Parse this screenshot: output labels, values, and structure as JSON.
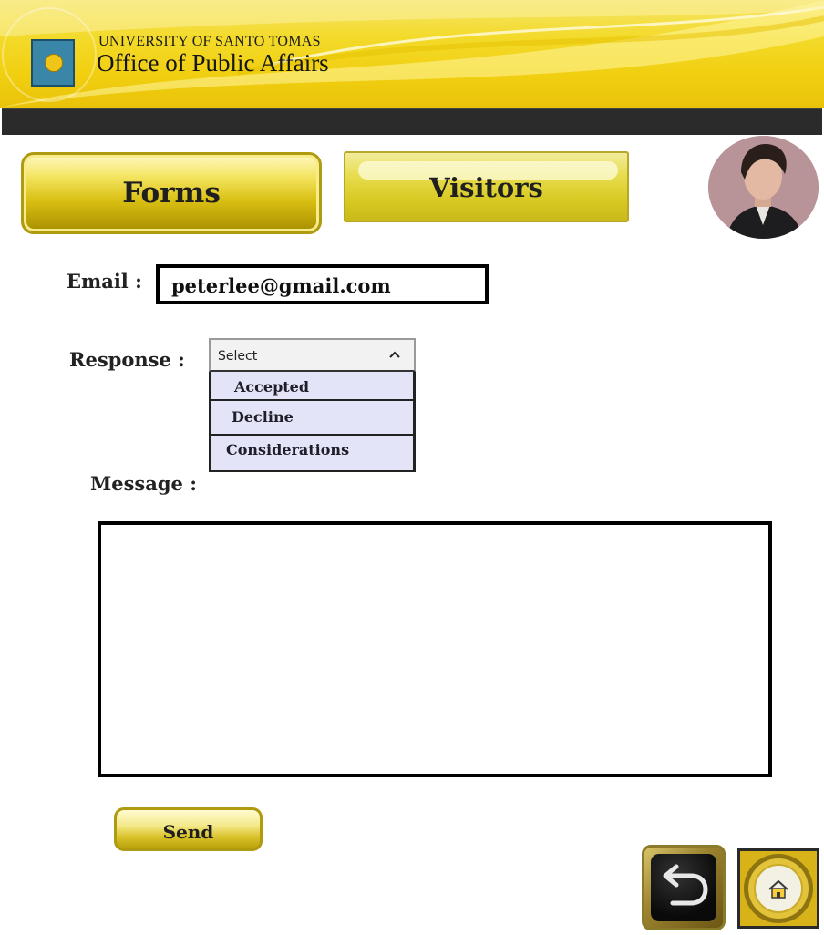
{
  "header": {
    "university": "UNIVERSITY OF SANTO TOMAS",
    "office": "Office of Public Affairs"
  },
  "tabs": [
    {
      "label": "Forms",
      "active": true
    },
    {
      "label": "Visitors",
      "active": false
    }
  ],
  "form": {
    "email_label": "Email :",
    "email_value": "peterlee@gmail.com",
    "response_label": "Response :",
    "response_selected": "Select",
    "response_options": [
      "Accepted",
      "Decline",
      "Considerations"
    ],
    "message_label": "Message :",
    "message_value": "",
    "send_label": "Send"
  },
  "icons": {
    "back": "back-arrow-icon",
    "home": "home-icon",
    "dropdown": "chevron-up-icon",
    "seal": "university-seal-icon"
  },
  "colors": {
    "brand_yellow": "#f1cf10",
    "dark_bar": "#2b2b2b",
    "dropdown_bg": "#e4e4f8"
  }
}
